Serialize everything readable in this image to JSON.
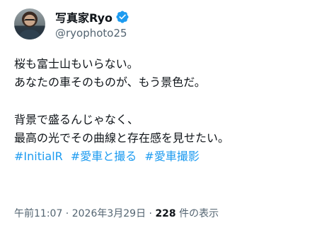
{
  "user": {
    "display_name": "写真家Ryo",
    "handle": "@ryophoto25",
    "verified_color": "#1d9bf0"
  },
  "tweet": {
    "lines": [
      "桜も富士山もいらない。",
      "あなたの車そのものが、もう景色だ。",
      "",
      "背景で盛るんじゃなく、",
      "最高の光でその曲線と存在感を見せたい。"
    ],
    "hashtags": [
      "#InitialR",
      "#愛車と撮る",
      "#愛車撮影"
    ]
  },
  "meta": {
    "time": "午前11:07",
    "separator": " · ",
    "date": "2026年3月29日",
    "separator2": " · ",
    "views_count": "228",
    "views_label": " 件の表示"
  },
  "colors": {
    "link": "#1d9bf0",
    "text": "#0f1419",
    "secondary": "#536471"
  },
  "icons": {
    "verified": "verified-badge-icon",
    "avatar": "profile-photo"
  }
}
